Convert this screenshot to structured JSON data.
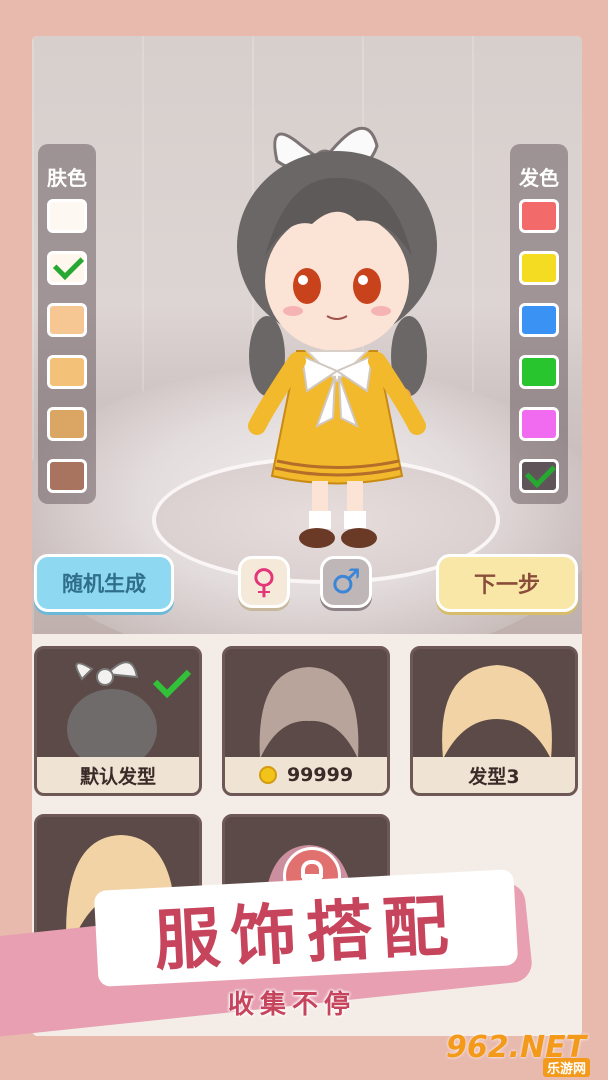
{
  "skin_panel": {
    "title": "肤色",
    "swatches": [
      "#fdf8f2",
      "#fff6ee",
      "#f6c792",
      "#f3c278",
      "#dba563",
      "#a8735f"
    ],
    "selected_index": 1
  },
  "hair_panel": {
    "title": "发色",
    "swatches": [
      "#f26a6a",
      "#f4dc22",
      "#3a93f4",
      "#28c52e",
      "#f06bf0",
      "#5f5558"
    ],
    "selected_index": 5
  },
  "buttons": {
    "random": "随机生成",
    "female_icon": "♀",
    "male_icon": "♂",
    "next": "下一步"
  },
  "hair_cards": [
    {
      "label": "默认发型",
      "selected": true
    },
    {
      "label": "99999",
      "priced": true
    },
    {
      "label": "发型3"
    }
  ],
  "banner": {
    "title": "服饰搭配",
    "subtitle": "收集不停"
  },
  "watermark": {
    "main": "962.NET",
    "sub": "乐游网"
  }
}
